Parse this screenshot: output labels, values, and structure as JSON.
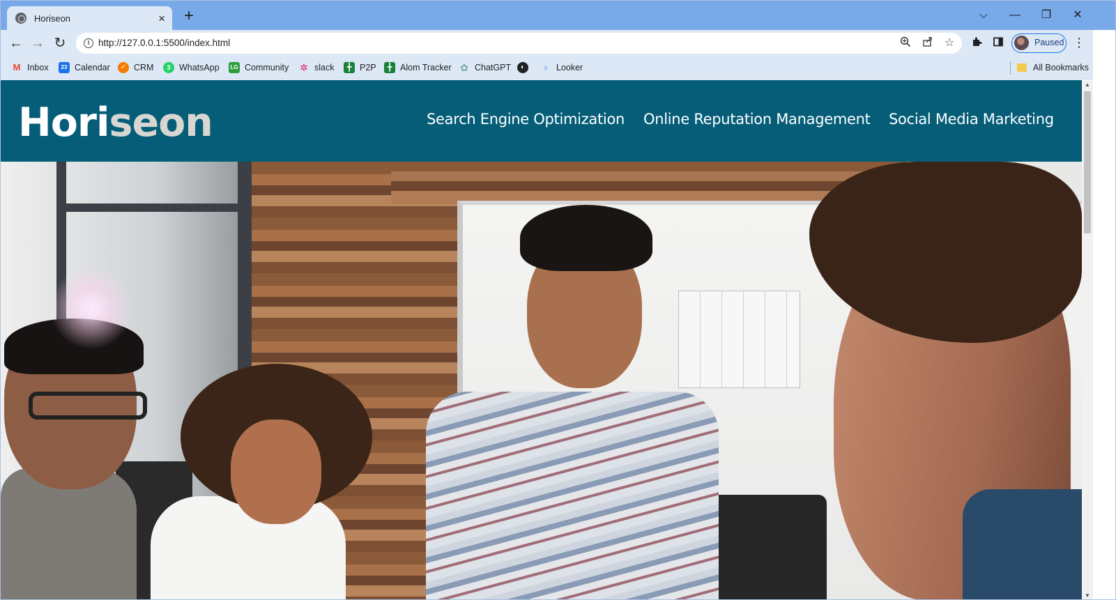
{
  "browser": {
    "tab": {
      "title": "Horiseon",
      "favicon": "globe-icon"
    },
    "new_tab_label": "+",
    "window_controls": {
      "dropdown": "⌵",
      "minimize": "—",
      "restore": "❐",
      "close": "✕"
    },
    "nav": {
      "back": "←",
      "forward": "→",
      "reload": "↻"
    },
    "url": "http://127.0.0.1:5500/index.html",
    "omnibox_icons": [
      "zoom-icon",
      "share-icon",
      "star-icon"
    ],
    "profile_label": "Paused",
    "bookmarks": [
      {
        "label": "Inbox",
        "icon": "gmail-icon",
        "color": "#ea4335"
      },
      {
        "label": "Calendar",
        "icon": "calendar-icon",
        "color": "#1a73e8"
      },
      {
        "label": "CRM",
        "icon": "crm-icon",
        "color": "#f57c00"
      },
      {
        "label": "WhatsApp",
        "icon": "whatsapp-icon",
        "color": "#25d366"
      },
      {
        "label": "Community",
        "icon": "community-icon",
        "color": "#2e9e3e"
      },
      {
        "label": "slack",
        "icon": "slack-icon",
        "color": "#611f69"
      },
      {
        "label": "P2P",
        "icon": "sheets-icon",
        "color": "#188038"
      },
      {
        "label": "Alom Tracker",
        "icon": "sheets-icon",
        "color": "#188038"
      },
      {
        "label": "ChatGPT",
        "icon": "chatgpt-icon",
        "color": "#74aa9c"
      },
      {
        "label": "",
        "icon": "globe-icon",
        "color": "#202124"
      },
      {
        "label": "Looker",
        "icon": "looker-icon",
        "color": "#4285f4"
      }
    ],
    "all_bookmarks": "All Bookmarks"
  },
  "page": {
    "brand_main": "Hori",
    "brand_accent": "seon",
    "nav": [
      "Search Engine Optimization",
      "Online Reputation Management",
      "Social Media Marketing"
    ],
    "hero_image": "team-meeting-photo",
    "colors": {
      "header_bg": "#055d78",
      "brand_accent": "#d7d6d1"
    }
  }
}
